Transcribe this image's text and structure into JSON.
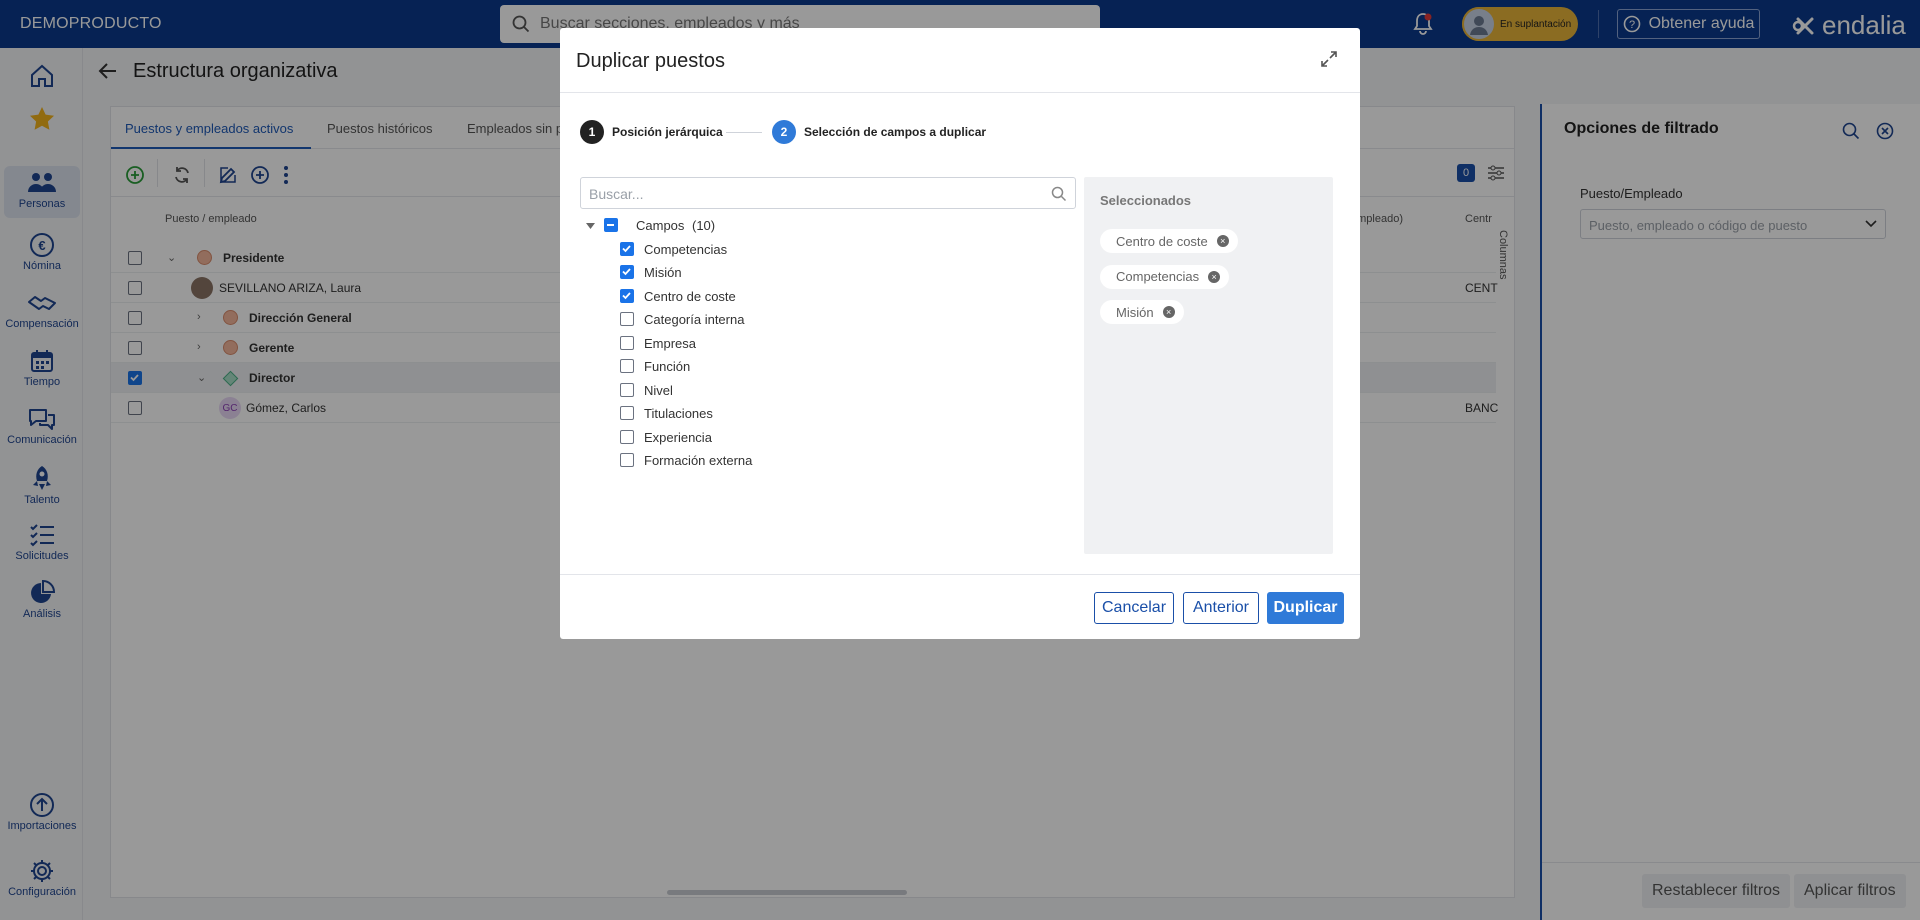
{
  "app": {
    "brand": "DEMOPRODUCTO",
    "search_placeholder": "Buscar secciones, empleados y más",
    "impersonation_label": "En suplantación",
    "help_label": "Obtener ayuda",
    "logo_text": "endalia"
  },
  "sidebar": {
    "items": [
      {
        "label": "",
        "icon": "home-icon"
      },
      {
        "label": "",
        "icon": "star-icon"
      },
      {
        "label": "Personas",
        "icon": "people-icon"
      },
      {
        "label": "Nómina",
        "icon": "euro-icon"
      },
      {
        "label": "Compensación",
        "icon": "handshake-icon"
      },
      {
        "label": "Tiempo",
        "icon": "calendar-icon"
      },
      {
        "label": "Comunicación",
        "icon": "chat-icon"
      },
      {
        "label": "Talento",
        "icon": "rocket-icon"
      },
      {
        "label": "Solicitudes",
        "icon": "checklist-icon"
      },
      {
        "label": "Análisis",
        "icon": "pie-chart-icon"
      },
      {
        "label": "Importaciones",
        "icon": "upload-icon"
      },
      {
        "label": "Configuración",
        "icon": "gear-icon"
      }
    ]
  },
  "page": {
    "title": "Estructura organizativa",
    "tabs": [
      "Puestos y empleados activos",
      "Puestos históricos",
      "Empleados sin p"
    ],
    "columns": {
      "position": "Puesto / empleado",
      "right_partial": "empleado)",
      "centro_partial": "Centr"
    },
    "filter_count": "0",
    "columns_button": "Columnas",
    "rows": [
      {
        "label": "Presidente",
        "bold": true
      },
      {
        "label": "SEVILLANO ARIZA, Laura",
        "bold": false,
        "extra": "CENT"
      },
      {
        "label": "Dirección General",
        "bold": true
      },
      {
        "label": "Gerente",
        "bold": true
      },
      {
        "label": "Director",
        "bold": true
      },
      {
        "label": "Gómez, Carlos",
        "bold": false,
        "initials": "GC",
        "extra": "BANC"
      }
    ]
  },
  "filter_panel": {
    "title": "Opciones de filtrado",
    "field_label": "Puesto/Empleado",
    "field_placeholder": "Puesto, empleado o código de puesto",
    "reset_label": "Restablecer filtros",
    "apply_label": "Aplicar filtros"
  },
  "modal": {
    "title": "Duplicar puestos",
    "steps": [
      {
        "number": "1",
        "label": "Posición jerárquica"
      },
      {
        "number": "2",
        "label": "Selección de campos a duplicar"
      }
    ],
    "search_placeholder": "Buscar...",
    "root_label": "Campos",
    "root_count": "(10)",
    "fields": [
      {
        "label": "Competencias",
        "checked": true
      },
      {
        "label": "Misión",
        "checked": true
      },
      {
        "label": "Centro de coste",
        "checked": true
      },
      {
        "label": "Categoría interna",
        "checked": false
      },
      {
        "label": "Empresa",
        "checked": false
      },
      {
        "label": "Función",
        "checked": false
      },
      {
        "label": "Nivel",
        "checked": false
      },
      {
        "label": "Titulaciones",
        "checked": false
      },
      {
        "label": "Experiencia",
        "checked": false
      },
      {
        "label": "Formación externa",
        "checked": false
      }
    ],
    "selected_title": "Seleccionados",
    "selected_chips": [
      "Centro de coste",
      "Competencias",
      "Misión"
    ],
    "buttons": {
      "cancel": "Cancelar",
      "previous": "Anterior",
      "duplicate": "Duplicar"
    }
  },
  "colors": {
    "topbar": "#0a3a8c",
    "primary": "#2f7ad8",
    "checkbox": "#1a73e8"
  }
}
